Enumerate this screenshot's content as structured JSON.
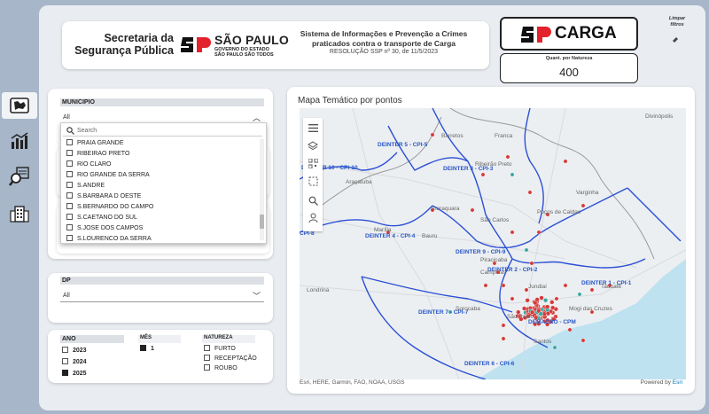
{
  "sidebar": {
    "items": [
      {
        "icon": "map-icon",
        "active": true
      },
      {
        "icon": "bar-chart-icon",
        "active": false
      },
      {
        "icon": "magnifier-icon",
        "active": false
      },
      {
        "icon": "building-icon",
        "active": false
      }
    ]
  },
  "header": {
    "logo_line1": "Secretaria da",
    "logo_line2": "Segurança Pública",
    "sp_title": "SÃO PAULO",
    "sp_sub1": "GOVERNO DO ESTADO",
    "sp_sub2": "SÃO PAULO SÃO TODOS",
    "sys_line1": "Sistema de Informações e Prevenção a Crimes",
    "sys_line2": "praticados contra o transporte de Carga",
    "sys_resolution": "RESOLUÇÃO SSP nº 30, de 11/5/2023"
  },
  "carga": {
    "title": "CARGA"
  },
  "kpi": {
    "label": "Quant. por Natureza",
    "value": "400"
  },
  "clear_filters": {
    "line1": "Limpar",
    "line2": "filtros"
  },
  "municipio": {
    "label": "MUNICIPIO",
    "selected": "All",
    "search_placeholder": "Search",
    "items": [
      "PRAIA GRANDE",
      "RIBEIRAO PRETO",
      "RIO CLARO",
      "RIO GRANDE DA SERRA",
      "S.ANDRE",
      "S.BARBARA D OESTE",
      "S.BERNARDO DO CAMPO",
      "S.CAETANO DO SUL",
      "S.JOSE DOS CAMPOS",
      "S.LOURENCO DA SERRA"
    ]
  },
  "dp": {
    "label": "DP",
    "selected": "All"
  },
  "ano": {
    "label": "ANO",
    "options": [
      {
        "label": "2023",
        "checked": false
      },
      {
        "label": "2024",
        "checked": false
      },
      {
        "label": "2025",
        "checked": true
      }
    ]
  },
  "mes": {
    "label": "MÊS",
    "options": [
      {
        "label": "1",
        "checked": true
      }
    ]
  },
  "natureza": {
    "label": "NATUREZA",
    "options": [
      {
        "label": "FURTO",
        "checked": false
      },
      {
        "label": "RECEPTAÇÃO",
        "checked": false
      },
      {
        "label": "ROUBO",
        "checked": false
      }
    ]
  },
  "map": {
    "title": "Mapa Temático por pontos",
    "attribution": "Esri, HERE, Garmin, FAO, NOAA, USGS",
    "powered_prefix": "Powered by ",
    "powered_brand": "Esri",
    "regions": [
      "DEINTER 5 - CPI-5",
      "DEINTER 3 - CPI-3",
      "DEINTER 10 - CPI-10",
      "DEINTER 4 - CPI-4",
      "DEINTER 9 - CPI-9",
      "DEINTER 2 - CPI-2",
      "DEINTER 1 - CPI-1",
      "DEINTER 7 - CPI-7",
      "DEMACRO - CPM",
      "DEINTER 6 - CPI-6",
      "CPI-8"
    ],
    "cities": [
      "Barretos",
      "Franca",
      "Ribeirão Preto",
      "Divinópolis",
      "Araçatuba",
      "Araraquara",
      "São Carlos",
      "Varginha",
      "Poços de Caldas",
      "Marília",
      "Bauru",
      "Piracicaba",
      "Campinas",
      "Jundiaí",
      "Taubaté",
      "Londrina",
      "Sorocaba",
      "São Paulo",
      "Mogi das Cruzes",
      "Santos"
    ],
    "colors": {
      "region_border": "#2b50d6",
      "point_red": "#d53a3a",
      "point_teal": "#3aa6a0",
      "water": "#bfe2f0"
    }
  }
}
